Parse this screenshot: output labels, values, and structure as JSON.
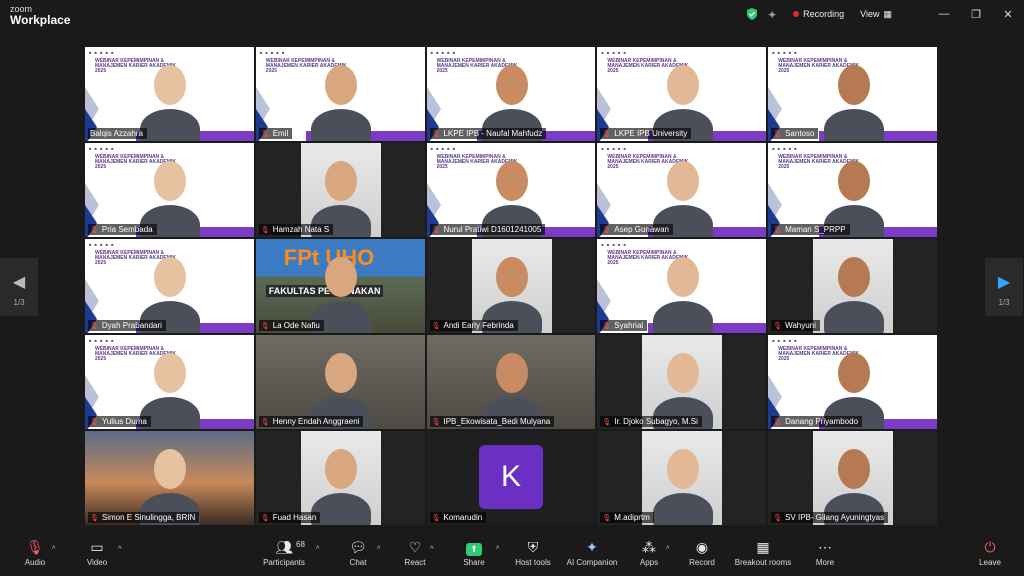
{
  "app": {
    "brand_top": "zoom",
    "brand_bottom": "Workplace"
  },
  "topbar": {
    "recording_label": "Recording",
    "view_label": "View"
  },
  "nav": {
    "left_page": "1/3",
    "right_page": "1/3"
  },
  "slide": {
    "title": "WEBINAR KEPEMIMPINAN & MANAJEMEN KARIER AKADEMIK 2025",
    "uho_sign": "FPt UHO",
    "faculty_sign": "FAKULTAS PETERNAKAN"
  },
  "participants": [
    {
      "name": "Balqis Azzahra",
      "muted": false,
      "speaking": true
    },
    {
      "name": "Emil",
      "muted": true
    },
    {
      "name": "LKPE IPB - Naufal Mahfudz",
      "muted": true
    },
    {
      "name": "LKPE IPB University",
      "muted": true
    },
    {
      "name": "Santoso",
      "muted": true
    },
    {
      "name": "Pria Sembada",
      "muted": true
    },
    {
      "name": "Hamzah Nata S",
      "muted": true
    },
    {
      "name": "Nurul Pratiwi D1601241005",
      "muted": true
    },
    {
      "name": "Asep Gunawan",
      "muted": true
    },
    {
      "name": "Maman S_PRPP",
      "muted": true
    },
    {
      "name": "Dyah Prabandari",
      "muted": true
    },
    {
      "name": "La Ode Nafiu",
      "muted": true
    },
    {
      "name": "Andi Early Febrinda",
      "muted": true
    },
    {
      "name": "Syahrial",
      "muted": true
    },
    {
      "name": "Wahyuni",
      "muted": true
    },
    {
      "name": "Yulius Duma",
      "muted": true
    },
    {
      "name": "Henny Endah Anggraeni",
      "muted": true
    },
    {
      "name": "IPB_Ekowisata_Bedi Mulyana",
      "muted": true
    },
    {
      "name": "Ir. Djoko Subagyo, M.Si",
      "muted": true
    },
    {
      "name": "Danang Priyambodo",
      "muted": true
    },
    {
      "name": "Simon E Sinulingga, BRIN",
      "muted": true
    },
    {
      "name": "Fuad Hasan",
      "muted": true
    },
    {
      "name": "Komarudin",
      "muted": true,
      "avatar_letter": "K"
    },
    {
      "name": "M.adiprtm",
      "muted": true
    },
    {
      "name": "SV IPB- Gilang Ayuningtyas",
      "muted": true
    }
  ],
  "toolbar": {
    "audio": "Audio",
    "video": "Video",
    "participants": "Participants",
    "participants_count": "68",
    "chat": "Chat",
    "react": "React",
    "share": "Share",
    "host_tools": "Host tools",
    "ai_companion": "AI Companion",
    "apps": "Apps",
    "record": "Record",
    "breakout": "Breakout rooms",
    "more": "More",
    "leave": "Leave"
  },
  "colors": {
    "background": "#1a1a1a",
    "speaking_border": "#2ecc71",
    "recording_dot": "#e02828",
    "slide_purple": "#7a3cc4",
    "slide_navy": "#213a8f",
    "share_green": "#2ecc71",
    "avatar_purple": "#6c2fc4"
  }
}
